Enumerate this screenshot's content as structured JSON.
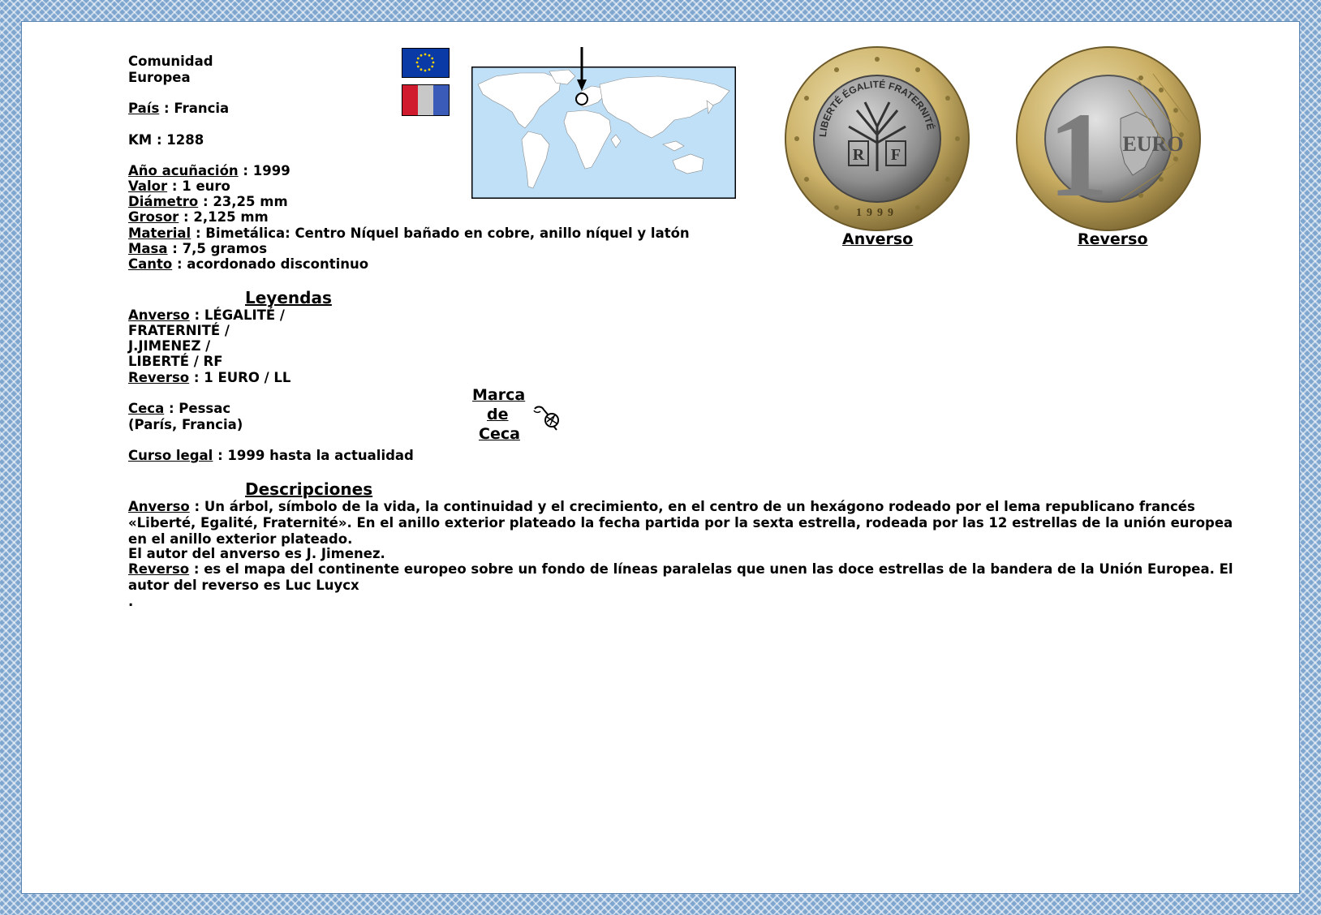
{
  "community": {
    "line1": "Comunidad",
    "line2": "Europea"
  },
  "country": {
    "label": "País",
    "value": " : Francia"
  },
  "km": "KM : 1288",
  "specs": [
    {
      "label": "Año acuñación",
      "value": " : 1999"
    },
    {
      "label": "Valor",
      "value": " : 1 euro"
    },
    {
      "label": "Diámetro",
      "value": " : 23,25 mm"
    },
    {
      "label": "Grosor",
      "value": " : 2,125 mm"
    },
    {
      "label": "Material",
      "value": " : Bimetálica: Centro Níquel bañado en cobre, anillo níquel y latón"
    },
    {
      "label": "Masa",
      "value": " : 7,5 gramos"
    },
    {
      "label": "Canto",
      "value": " : acordonado discontinuo"
    }
  ],
  "legends": {
    "title": "Leyendas",
    "obverse_label": "Anverso",
    "obverse_lines": [
      " : LÉGALITÉ /",
      "FRATERNITÉ /",
      "J.JIMENEZ /",
      "LIBERTÉ / RF"
    ],
    "reverse_label": "Reverso",
    "reverse_value": " : 1 EURO / LL"
  },
  "mint": {
    "label": "Ceca",
    "value": " : Pessac",
    "line2": "(París, Francia)"
  },
  "mint_mark": {
    "line1": "Marca",
    "line2": "de",
    "line3": "Ceca"
  },
  "legal_tender": {
    "label": "Curso legal",
    "value": " : 1999 hasta la actualidad"
  },
  "descriptions": {
    "title": "Descripciones",
    "obverse_label": "Anverso",
    "obverse_text": " : Un árbol,  símbolo de la vida, la continuidad y el crecimiento, en el centro de un hexágono rodeado por el lema republicano francés «Liberté, Egalité, Fraternité». En el anillo exterior plateado la fecha partida por la sexta estrella, rodeada por las 12 estrellas de la unión europea en el anillo exterior plateado.",
    "author_obverse": "El autor del anverso es J. Jimenez.",
    "reverse_label": "Reverso",
    "reverse_text": " : es el mapa del continente europeo sobre un fondo de líneas paralelas que unen las doce estrellas de la bandera de la Unión Europea. El autor del reverso es Luc Luycx",
    "trailing": "."
  },
  "coin_captions": {
    "obverse": "Anverso",
    "reverse": "Reverso"
  },
  "coin_text": {
    "obverse_motto": "LIBERTÉ ÉGALITÉ FRATERNITÉ",
    "obverse_initials": [
      "R",
      "F"
    ],
    "obverse_year": "1999",
    "reverse_value": "1",
    "reverse_unit": "EURO"
  },
  "colors": {
    "frame": "#7fa6cf",
    "eu_blue": "#0a3aa6",
    "eu_star": "#f5d100",
    "fr_blue": "#3a5bb8",
    "fr_white": "#c8c8c8",
    "fr_red": "#d01a2e",
    "map_ocean": "#bfe0f7"
  },
  "icons": [
    "eu-flag",
    "france-flag",
    "world-map",
    "location-arrow",
    "mint-mark-icon"
  ]
}
